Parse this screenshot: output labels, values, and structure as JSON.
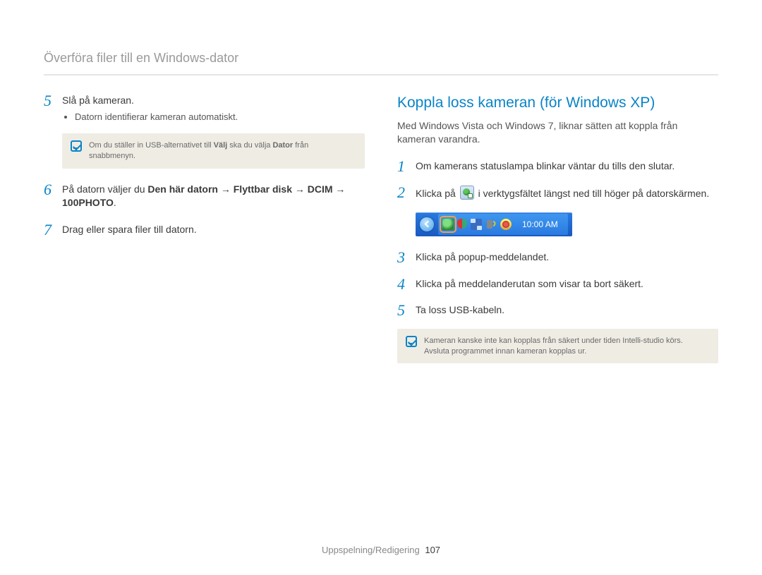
{
  "header": {
    "title": "Överföra filer till en Windows-dator"
  },
  "left": {
    "steps": [
      {
        "num": "5",
        "text": "Slå på kameran.",
        "bullets": [
          "Datorn identifierar kameran automatiskt."
        ],
        "note": {
          "pre": "Om du ställer in USB-alternativet till ",
          "b1": "Välj",
          "mid": " ska du välja ",
          "b2": "Dator",
          "post": " från snabbmenyn."
        }
      },
      {
        "num": "6",
        "pre": "På datorn väljer du ",
        "bold": "Den här datorn → Flyttbar disk → DCIM → 100PHOTO",
        "post": "."
      },
      {
        "num": "7",
        "text": "Drag eller spara filer till datorn."
      }
    ]
  },
  "right": {
    "title": "Koppla loss kameran (för Windows XP)",
    "intro": "Med Windows Vista och Windows 7, liknar sätten att koppla från kameran varandra.",
    "steps": [
      {
        "num": "1",
        "text": "Om kamerans statuslampa blinkar väntar du tills den slutar."
      },
      {
        "num": "2",
        "pre": "Klicka på ",
        "post": " i verktygsfältet längst ned till höger på datorskärmen."
      },
      {
        "num": "3",
        "text": "Klicka på popup-meddelandet."
      },
      {
        "num": "4",
        "text": "Klicka på meddelanderutan som visar ta bort säkert."
      },
      {
        "num": "5",
        "text": "Ta loss USB-kabeln."
      }
    ],
    "taskbar": {
      "clock": "10:00 AM"
    },
    "note": "Kameran kanske inte kan kopplas från säkert under tiden Intelli-studio körs. Avsluta programmet innan kameran kopplas ur."
  },
  "footer": {
    "section": "Uppspelning/Redigering",
    "page": "107"
  }
}
